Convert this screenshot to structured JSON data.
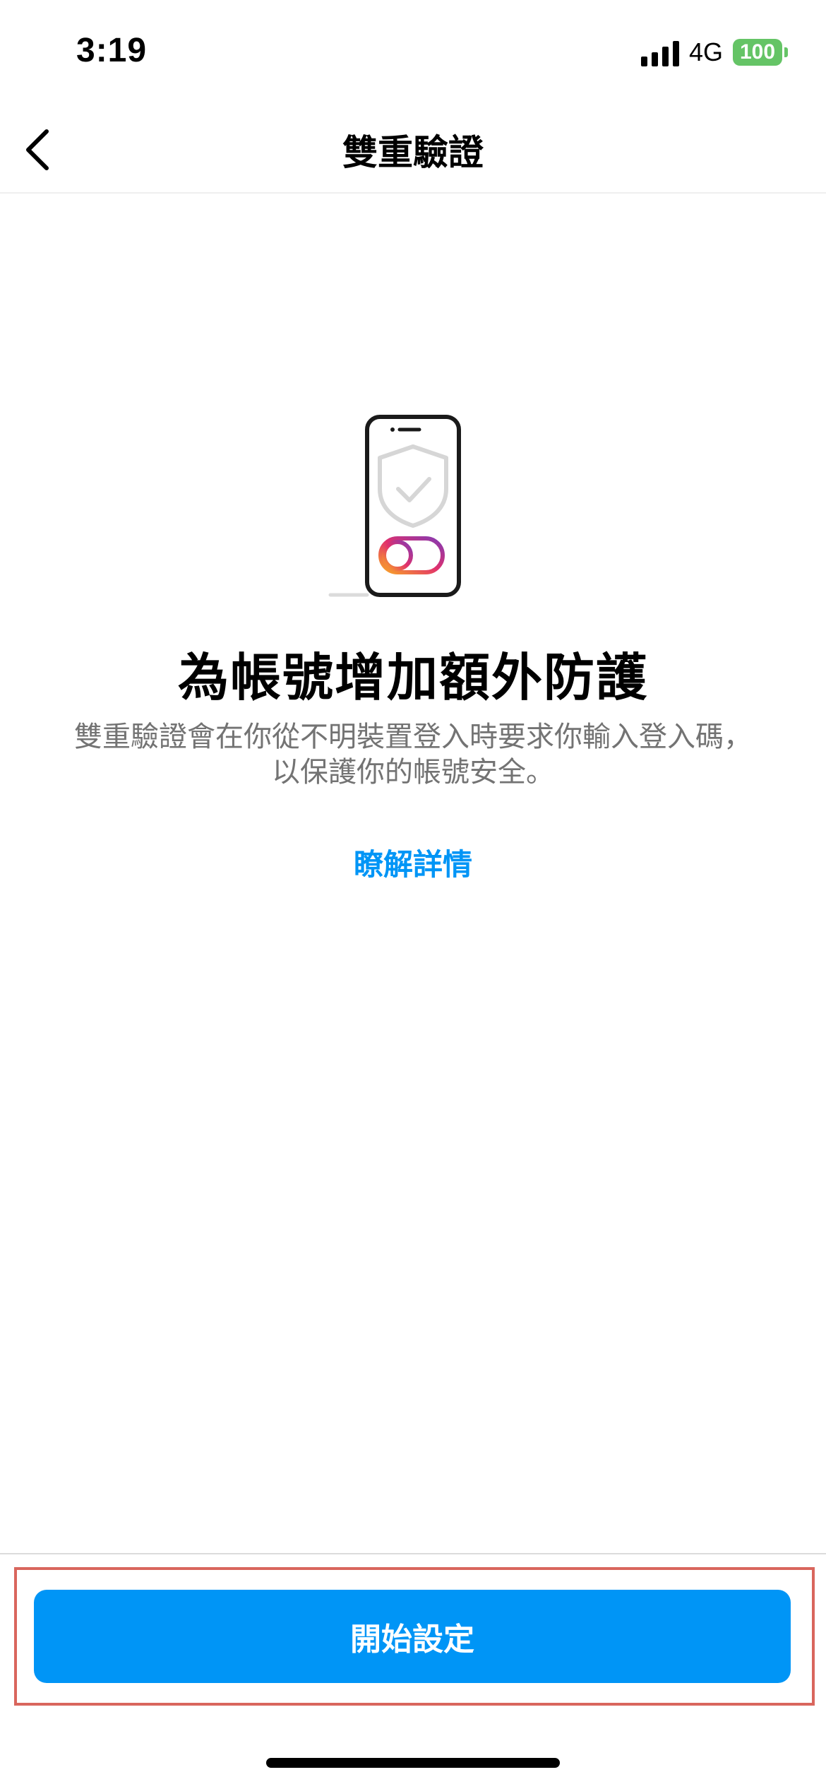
{
  "status_bar": {
    "time": "3:19",
    "network": "4G",
    "battery": "100",
    "battery_color": "#65c466"
  },
  "nav": {
    "title": "雙重驗證",
    "back_icon": "chevron-left-icon"
  },
  "illustration": {
    "icon": "phone-shield-toggle-icon"
  },
  "content": {
    "headline": "為帳號增加額外防護",
    "description": "雙重驗證會在你從不明裝置登入時要求你輸入登入碼，以保護你的帳號安全。",
    "learn_more": "瞭解詳情"
  },
  "footer": {
    "primary_button": "開始設定"
  },
  "colors": {
    "accent": "#0095f6",
    "secondary_text": "#737373",
    "highlight": "#d9665d"
  }
}
